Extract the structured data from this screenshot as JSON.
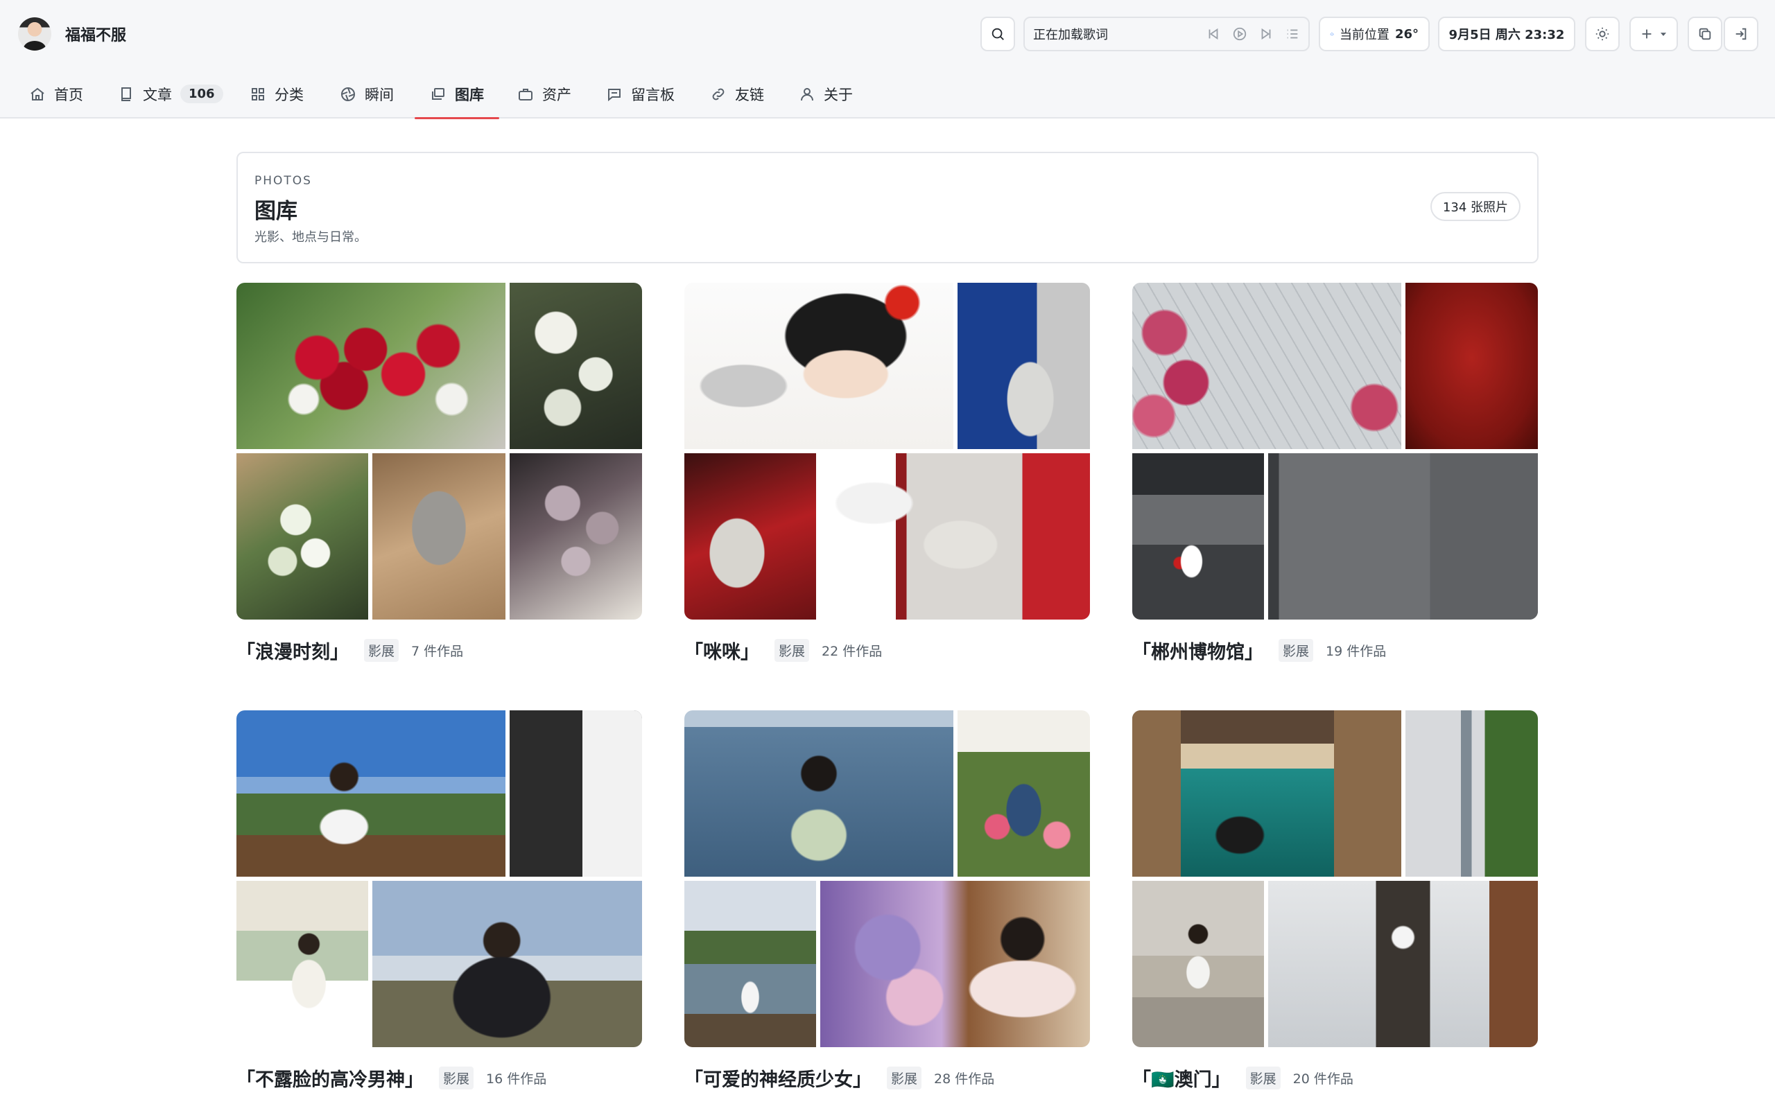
{
  "site": {
    "name": "福福不服"
  },
  "toolbar": {
    "lyrics": "正在加载歌词",
    "weather_label": "当前位置",
    "weather_temp": "26°",
    "datetime": "9月5日 周六 23:32"
  },
  "nav": {
    "items": [
      {
        "label": "首页",
        "icon": "home-icon"
      },
      {
        "label": "文章",
        "icon": "book-icon",
        "badge": "106"
      },
      {
        "label": "分类",
        "icon": "grid-icon"
      },
      {
        "label": "瞬间",
        "icon": "aperture-icon"
      },
      {
        "label": "图库",
        "icon": "gallery-icon",
        "active": true
      },
      {
        "label": "资产",
        "icon": "briefcase-icon"
      },
      {
        "label": "留言板",
        "icon": "message-icon"
      },
      {
        "label": "友链",
        "icon": "link-icon"
      },
      {
        "label": "关于",
        "icon": "user-icon"
      }
    ]
  },
  "intro": {
    "kicker": "PHOTOS",
    "title": "图库",
    "subtitle": "光影、地点与日常。",
    "count": "134 张照片"
  },
  "albums": [
    {
      "title": "「浪漫时刻」",
      "tag": "影展",
      "count": "7 件作品"
    },
    {
      "title": "「咪咪」",
      "tag": "影展",
      "count": "22 件作品"
    },
    {
      "title": "「郴州博物馆」",
      "tag": "影展",
      "count": "19 件作品"
    },
    {
      "title": "「不露脸的高冷男神」",
      "tag": "影展",
      "count": "16 件作品"
    },
    {
      "title": "「可爱的神经质少女」",
      "tag": "影展",
      "count": "28 件作品"
    },
    {
      "title": "「🇲🇴澳门」",
      "tag": "影展",
      "count": "20 件作品"
    }
  ],
  "colors": {
    "accent": "#e5484d",
    "background": "#ffffff",
    "header": "#f6f7f9"
  }
}
